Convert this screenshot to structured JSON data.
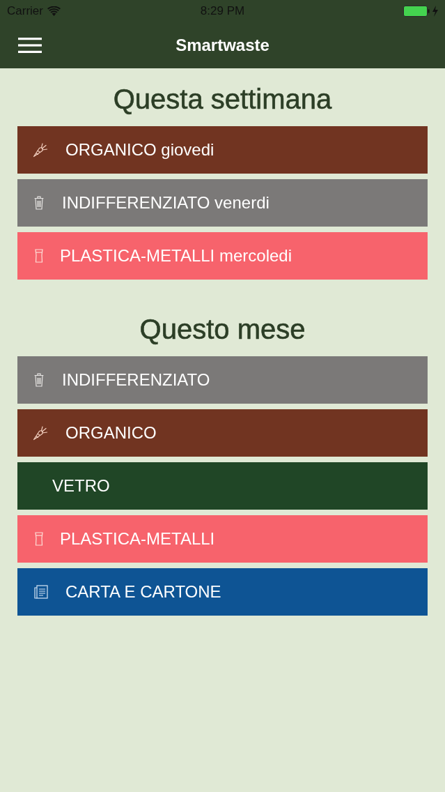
{
  "status_bar": {
    "carrier": "Carrier",
    "time": "8:29 PM"
  },
  "nav_bar": {
    "title": "Smartwaste"
  },
  "sections": [
    {
      "title": "Questa settimana",
      "items": [
        {
          "label": "ORGANICO giovedi",
          "kind": "organic",
          "color": "#713421"
        },
        {
          "label": "INDIFFERENZIATO venerdi",
          "kind": "residual",
          "color": "#7b7978"
        },
        {
          "label": "PLASTICA-METALLI mercoledi",
          "kind": "plastic",
          "color": "#f7636c"
        }
      ]
    },
    {
      "title": "Questo mese",
      "items": [
        {
          "label": "INDIFFERENZIATO",
          "kind": "residual",
          "color": "#7b7978"
        },
        {
          "label": "ORGANICO",
          "kind": "organic",
          "color": "#713421"
        },
        {
          "label": "VETRO",
          "kind": "glass",
          "color": "#204626"
        },
        {
          "label": "PLASTICA-METALLI",
          "kind": "plastic",
          "color": "#f7636c"
        },
        {
          "label": "CARTA E CARTONE",
          "kind": "paper",
          "color": "#0e5494"
        }
      ]
    }
  ]
}
